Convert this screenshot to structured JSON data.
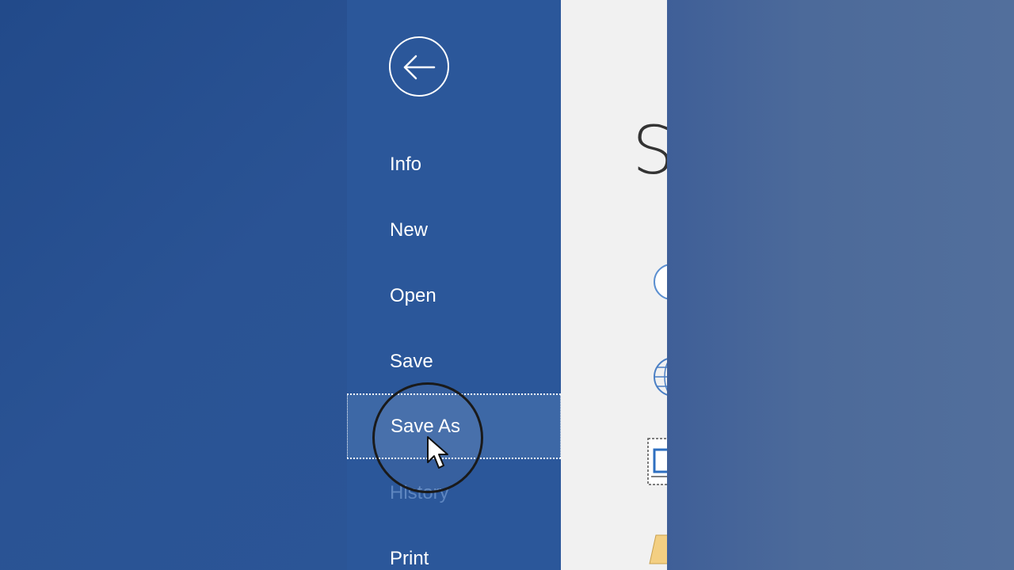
{
  "backstage": {
    "back_icon": "back-arrow-icon",
    "nav_items": [
      {
        "label": "Info"
      },
      {
        "label": "New"
      },
      {
        "label": "Open"
      },
      {
        "label": "Save"
      },
      {
        "label": "Save As",
        "state": "selected"
      },
      {
        "label": "History",
        "state": "disabled"
      },
      {
        "label": "Print"
      }
    ]
  },
  "content": {
    "title": "S",
    "icons": [
      "onedrive-icon",
      "globe-icon",
      "this-pc-icon",
      "folder-icon"
    ]
  },
  "colors": {
    "backstage_blue": "#2b579a",
    "selected_item": "#3d68a6",
    "content_bg": "#f1f1f1"
  }
}
